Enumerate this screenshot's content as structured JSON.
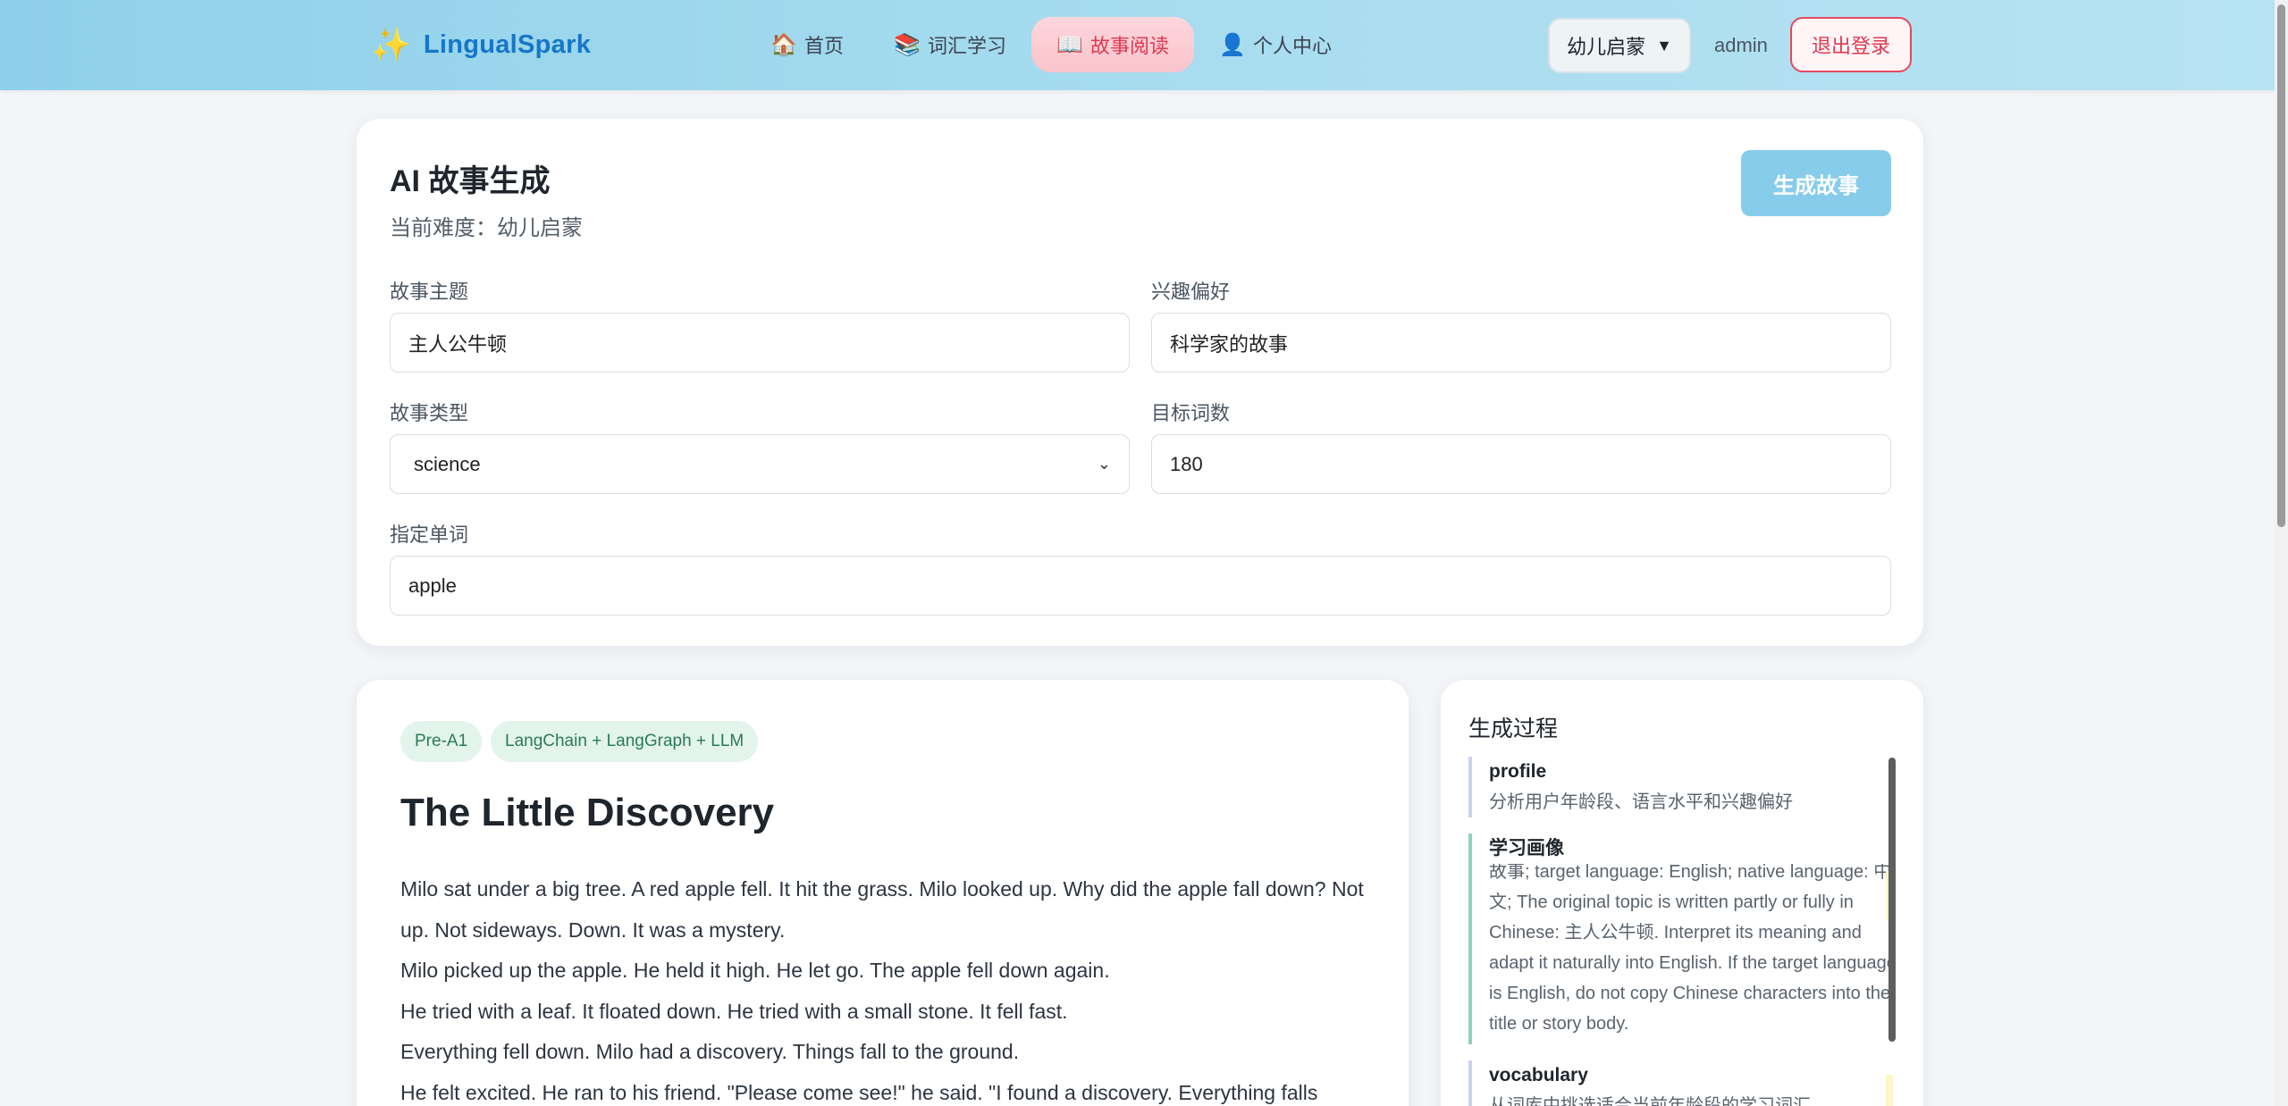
{
  "header": {
    "brand_icon": "sparkle-icon",
    "brand_name": "LingualSpark",
    "nav": [
      {
        "icon": "home-icon",
        "glyph": "🏠",
        "label": "首页",
        "active": false
      },
      {
        "icon": "books-icon",
        "glyph": "📚",
        "label": "词汇学习",
        "active": false
      },
      {
        "icon": "open-book-icon",
        "glyph": "📖",
        "label": "故事阅读",
        "active": true
      },
      {
        "icon": "person-icon",
        "glyph": "👤",
        "label": "个人中心",
        "active": false
      }
    ],
    "level_select": "幼儿启蒙",
    "user": "admin",
    "logout": "退出登录"
  },
  "generator": {
    "title": "AI 故事生成",
    "current_level": "当前难度：幼儿启蒙",
    "generate_button": "生成故事",
    "topic": {
      "label": "故事主题",
      "value": "主人公牛顿"
    },
    "interest": {
      "label": "兴趣偏好",
      "value": "科学家的故事"
    },
    "type": {
      "label": "故事类型",
      "value": "science"
    },
    "word_count": {
      "label": "目标词数",
      "value": "180"
    },
    "required_words": {
      "label": "指定单词",
      "value": "apple"
    }
  },
  "story": {
    "tags": [
      "Pre-A1",
      "LangChain + LangGraph + LLM"
    ],
    "title": "The Little Discovery",
    "paragraphs": [
      "Milo sat under a big tree. A red apple fell. It hit the grass. Milo looked up. Why did the apple fall down? Not up. Not sideways. Down. It was a mystery.",
      "Milo picked up the apple. He held it high. He let go. The apple fell down again.",
      "He tried with a leaf. It floated down. He tried with a small stone. It fell fast.",
      "Everything fell down. Milo had a discovery. Things fall to the ground.",
      "He felt excited. He ran to his friend. \"Please come see!\" he said. \"I found a discovery. Everything falls"
    ]
  },
  "process": {
    "title": "生成过程",
    "steps": [
      {
        "name": "profile",
        "desc": "分析用户年龄段、语言水平和兴趣偏好"
      },
      {
        "name": "学习画像",
        "desc": "故事; target language: English; native language: 中文; The original topic is written partly or fully in Chinese: 主人公牛顿. Interpret its meaning and adapt it naturally into English. If the target language is English, do not copy Chinese characters into the title or story body."
      },
      {
        "name": "vocabulary",
        "desc": "从词库中挑选适合当前年龄段的学习词汇"
      }
    ]
  },
  "colors": {
    "accent_blue": "#1676c8",
    "active_tab": "#e0384f",
    "tag_green": "#2c7a57",
    "generate_btn": "#87cdeb"
  }
}
